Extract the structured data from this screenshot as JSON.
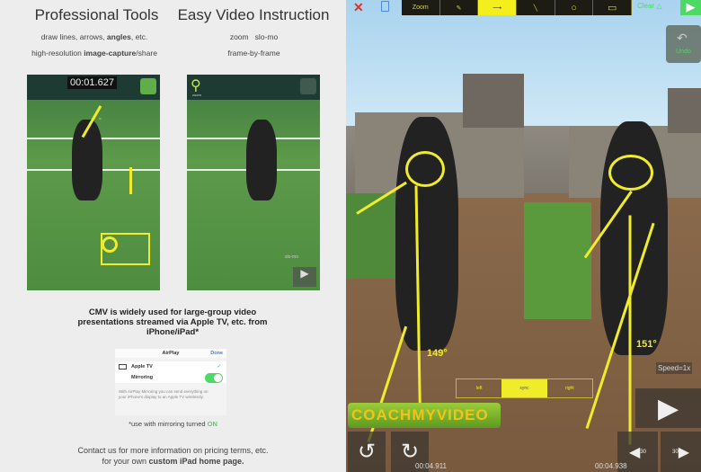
{
  "left": {
    "tools_title": "Professional Tools",
    "tools_line1_a": "draw lines, arrows, ",
    "tools_line1_b": "angles",
    "tools_line1_c": ", etc.",
    "tools_line2_a": "high-resolution ",
    "tools_line2_b": "image-capture",
    "tools_line2_c": "/share",
    "video_title": "Easy Video Instruction",
    "video_line1": "zoom   slo-mo",
    "video_line2": "frame-by-frame",
    "thumb1_time": "00:01.627",
    "thumb2_zoom": "zoom",
    "thumb2_slomo": "slo-mo",
    "cmv_text": "CMV is widely used for large-group video presentations streamed via Apple TV, etc. from iPhone/iPad*",
    "airplay": {
      "title": "AirPlay",
      "done": "Done",
      "device": "Apple TV",
      "mirroring": "Mirroring",
      "mirroring_on": true,
      "note": "With AirPlay Mirroring you can send everything on your iPhone's display to an Apple TV wirelessly."
    },
    "footnote_a": "*use with mirroring turned ",
    "footnote_b": "ON",
    "contact_a": "Contact us for more information on pricing terms, etc.",
    "contact_b": "for your own ",
    "contact_c": "custom iPad home page."
  },
  "right": {
    "toolbar": {
      "zoom": "Zoom",
      "selected": "arrow",
      "clear": "Clear"
    },
    "undo": "Undo",
    "angle_left": "149°",
    "angle_right": "151°",
    "speed": "Speed=1x",
    "sync_left": "left",
    "sync_mid": "sync",
    "sync_right": "right",
    "logo": "COACHMYVIDEO",
    "time_left": "00:04.911",
    "time_right": "00:04.938",
    "skip_back": "30",
    "skip_fwd": "30",
    "colors": {
      "accent": "#f1ec2a",
      "green": "#4cd964"
    }
  }
}
